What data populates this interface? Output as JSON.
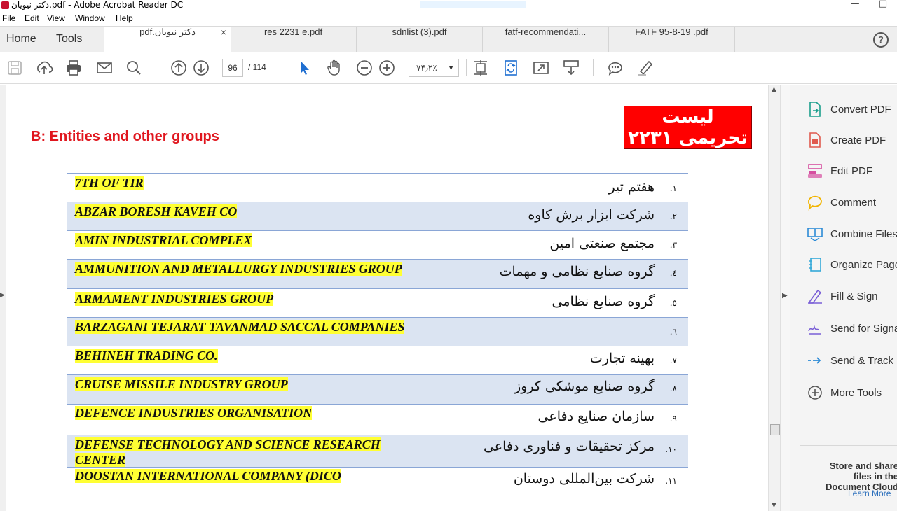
{
  "window": {
    "title": "دکتر نیویان.pdf - Adobe Acrobat Reader DC",
    "controls": [
      "—",
      "□"
    ]
  },
  "menu": [
    "File",
    "Edit",
    "View",
    "Window",
    "Help"
  ],
  "nav": {
    "home": "Home",
    "tools": "Tools"
  },
  "tabs": [
    {
      "label": "دکتر نیویان.pdf",
      "active": true,
      "close": "×"
    },
    {
      "label": "res 2231 e.pdf",
      "active": false
    },
    {
      "label": "sdnlist (3).pdf",
      "active": false
    },
    {
      "label": "fatf-recommendati...",
      "active": false
    },
    {
      "label": "FATF  95-8-19  .pdf",
      "active": false
    }
  ],
  "help": "?",
  "toolbar": {
    "page_current": "96",
    "page_total": "/ 114",
    "zoom": "۷۴٫۲٪",
    "icons": [
      "save-icon",
      "upload-icon",
      "print-icon",
      "email-icon",
      "search-icon",
      "page-up-icon",
      "page-down-icon",
      "select-arrow-icon",
      "hand-icon",
      "zoom-out-icon",
      "zoom-in-icon",
      "fit-page-icon",
      "rotate-icon",
      "fullscreen-icon",
      "scroll-mode-icon",
      "comment-icon",
      "highlight-pen-icon"
    ]
  },
  "document": {
    "badge": "لیست تحریمی ۲۲۳۱",
    "section_title": "B: Entities and other groups",
    "rows": [
      {
        "num": "۱.",
        "fa": "هفتم تیر",
        "en": "7TH OF TIR",
        "shaded": false
      },
      {
        "num": "۲.",
        "fa": "شرکت  ابزار برش کاوه",
        "en": "ABZAR BORESH KAVEH CO",
        "shaded": true
      },
      {
        "num": "۳.",
        "fa": "مجتمع صنعتی امین",
        "en": "AMIN INDUSTRIAL COMPLEX",
        "shaded": false
      },
      {
        "num": "٤.",
        "fa": "گروه صنایع نظامی و مهمات",
        "en": "AMMUNITION AND METALLURGY INDUSTRIES GROUP",
        "shaded": true
      },
      {
        "num": "٥.",
        "fa": "گروه صنایع نظامی",
        "en": "ARMAMENT INDUSTRIES GROUP",
        "shaded": false
      },
      {
        "num": "٦.",
        "fa": "",
        "en": "BARZAGANI TEJARAT TAVANMAD SACCAL  COMPANIES",
        "shaded": true
      },
      {
        "num": "۷.",
        "fa": "بهینه تجارت",
        "en": "BEHINEH TRADING CO.",
        "shaded": false
      },
      {
        "num": "۸.",
        "fa": "گروه صنایع موشکی کروز",
        "en": "CRUISE MISSILE INDUSTRY GROUP",
        "shaded": true
      },
      {
        "num": "۹.",
        "fa": "سازمان صنایع دفاعی",
        "en": "DEFENCE INDUSTRIES ORGANISATION",
        "shaded": false
      },
      {
        "num": "۱۰.",
        "fa": "مرکز تحقیقات و فناوری دفاعی",
        "en": "DEFENSE TECHNOLOGY AND SCIENCE RESEARCH CENTER",
        "shaded": true
      },
      {
        "num": "۱۱.",
        "fa": "شرکت بین‌المللی دوستان",
        "en": "DOOSTAN INTERNATIONAL COMPANY (DICO",
        "shaded": false
      }
    ]
  },
  "right_panel": {
    "tools": [
      {
        "label": "Convert PDF",
        "icon": "convert-pdf-icon",
        "color": "#1a9e8c"
      },
      {
        "label": "Create PDF",
        "icon": "create-pdf-icon",
        "color": "#e05a4e"
      },
      {
        "label": "Edit PDF",
        "icon": "edit-pdf-icon",
        "color": "#d64fa0"
      },
      {
        "label": "Comment",
        "icon": "comment-icon",
        "color": "#f2b400"
      },
      {
        "label": "Combine Files",
        "icon": "combine-files-icon",
        "color": "#2b8ad6"
      },
      {
        "label": "Organize Pages",
        "icon": "organize-pages-icon",
        "color": "#34a8d8"
      },
      {
        "label": "Fill & Sign",
        "icon": "fill-sign-icon",
        "color": "#7a5fd6"
      },
      {
        "label": "Send for Signature",
        "icon": "send-signature-icon",
        "color": "#7a5fd6"
      },
      {
        "label": "Send & Track",
        "icon": "send-track-icon",
        "color": "#2b8ad6"
      },
      {
        "label": "More Tools",
        "icon": "more-tools-icon",
        "color": "#555555"
      }
    ],
    "promo": "Store and share files in the Document Cloud",
    "learn_more": "Learn More"
  }
}
